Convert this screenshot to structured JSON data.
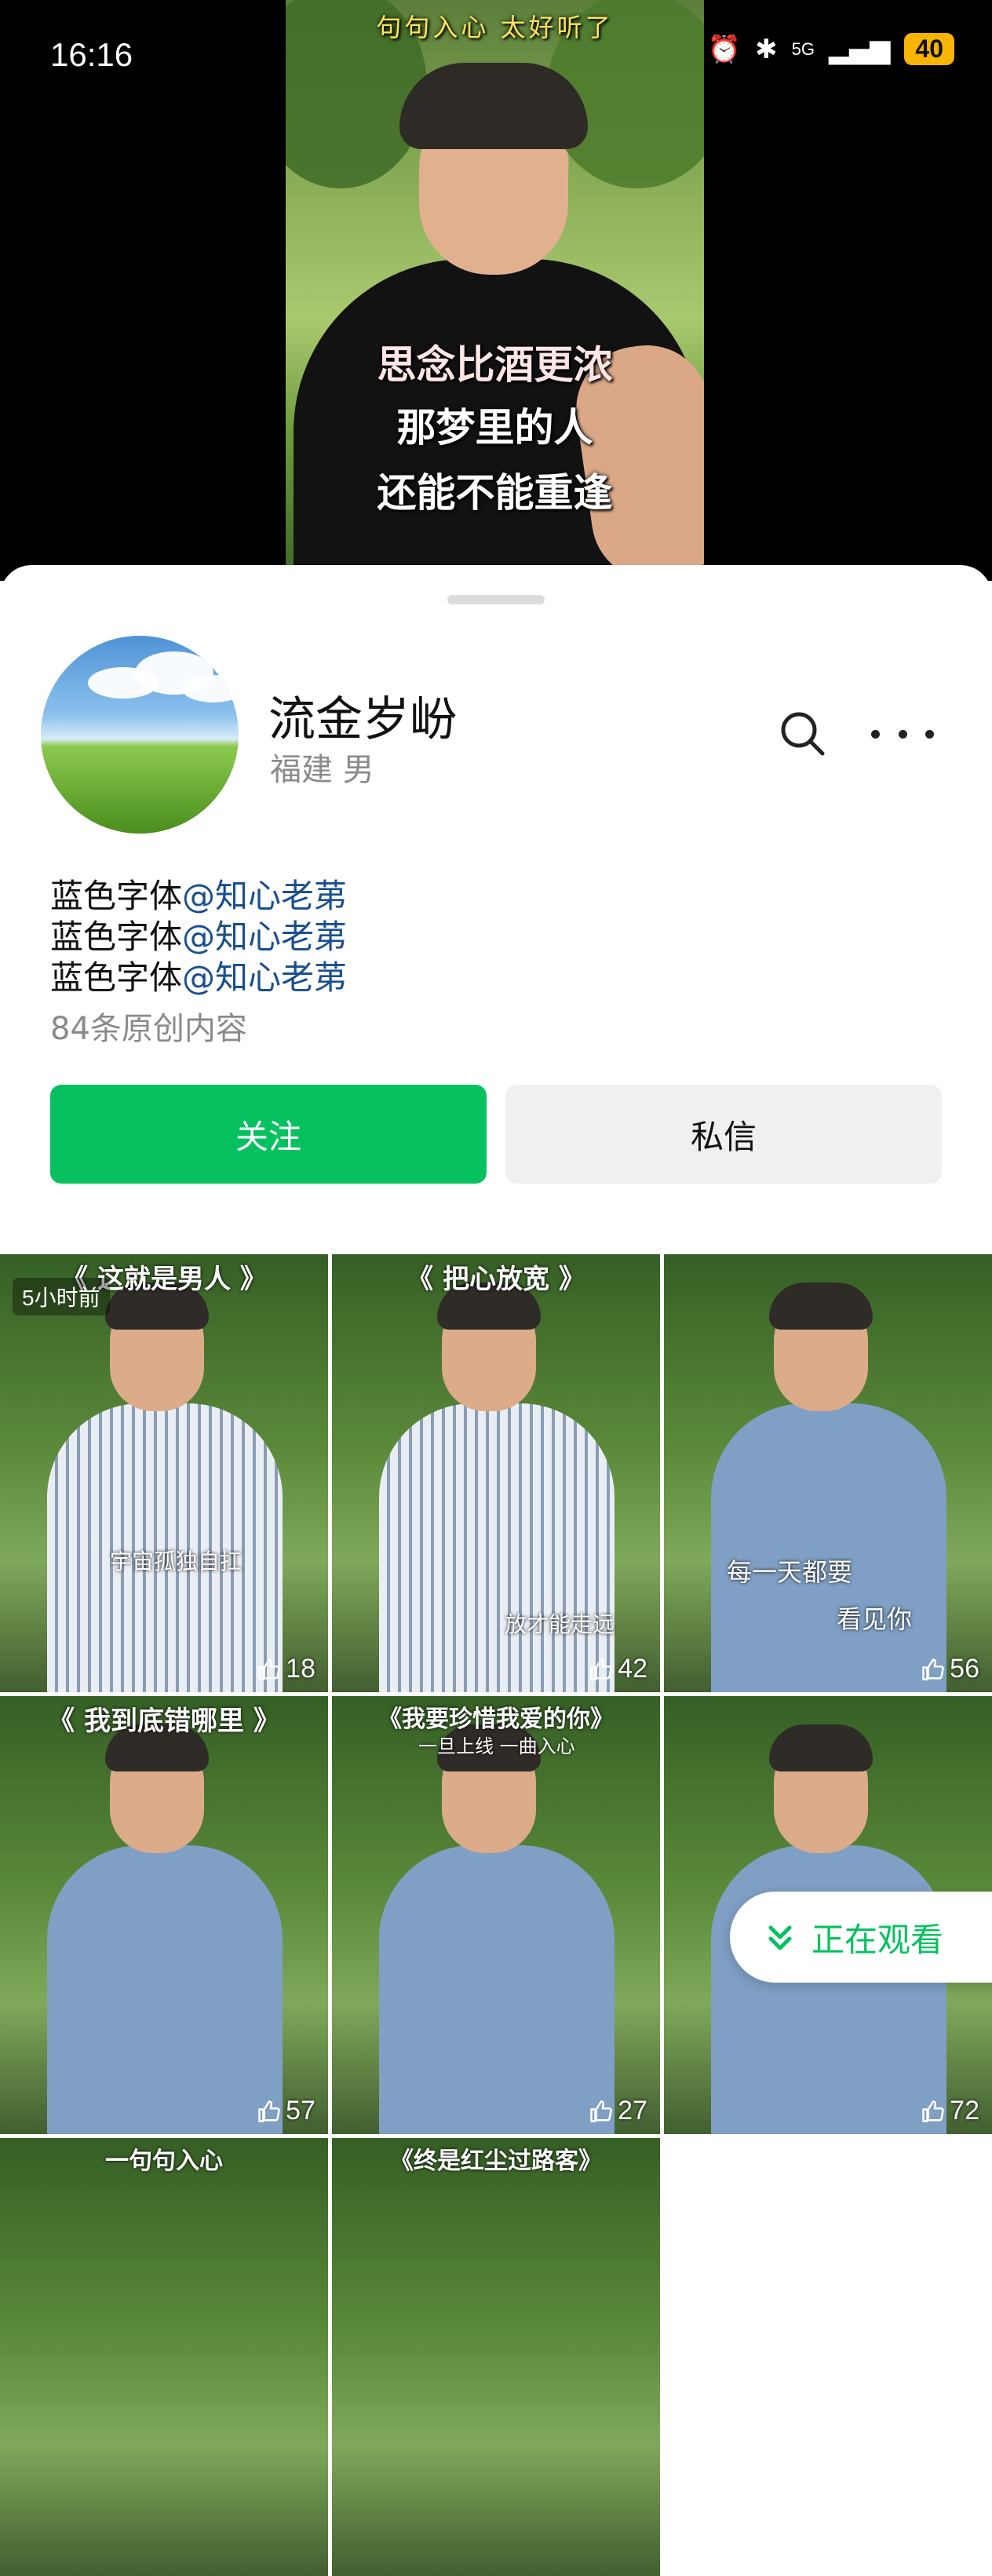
{
  "status_bar": {
    "time": "16:16",
    "network": "5G",
    "battery": "40"
  },
  "video": {
    "captions": [
      "句句入心 太好听了",
      "思念比酒更浓",
      "那梦里的人",
      "还能不能重逢"
    ]
  },
  "profile": {
    "name": "流金岁岎",
    "location": "福建 男",
    "bio": [
      {
        "text": "蓝色字体",
        "mention": "@知心老苐"
      },
      {
        "text": "蓝色字体",
        "mention": "@知心老苐"
      },
      {
        "text": "蓝色字体",
        "mention": "@知心老苐"
      }
    ],
    "original_count": "84条原创内容",
    "follow_label": "关注",
    "message_label": "私信"
  },
  "posts": [
    {
      "title": "《 这就是男人 》",
      "time": "5小时前",
      "overlay": "宇宙孤独自扛",
      "likes": "18"
    },
    {
      "title": "《 把心放宽 》",
      "overlay": "放才能走远",
      "likes": "42"
    },
    {
      "title": "",
      "overlay": "每一天都要",
      "overlay2": "看见你",
      "likes": "56"
    },
    {
      "title": "《 我到底错哪里 》",
      "likes": "57"
    },
    {
      "title": "《我要珍惜我爱的你》",
      "overlay": "一旦上线 一曲入心",
      "likes": "27"
    },
    {
      "title": "",
      "likes": "72"
    },
    {
      "title": "一句句入心"
    },
    {
      "title": "《终是红尘过路客》"
    }
  ],
  "watching_label": "正在观看"
}
